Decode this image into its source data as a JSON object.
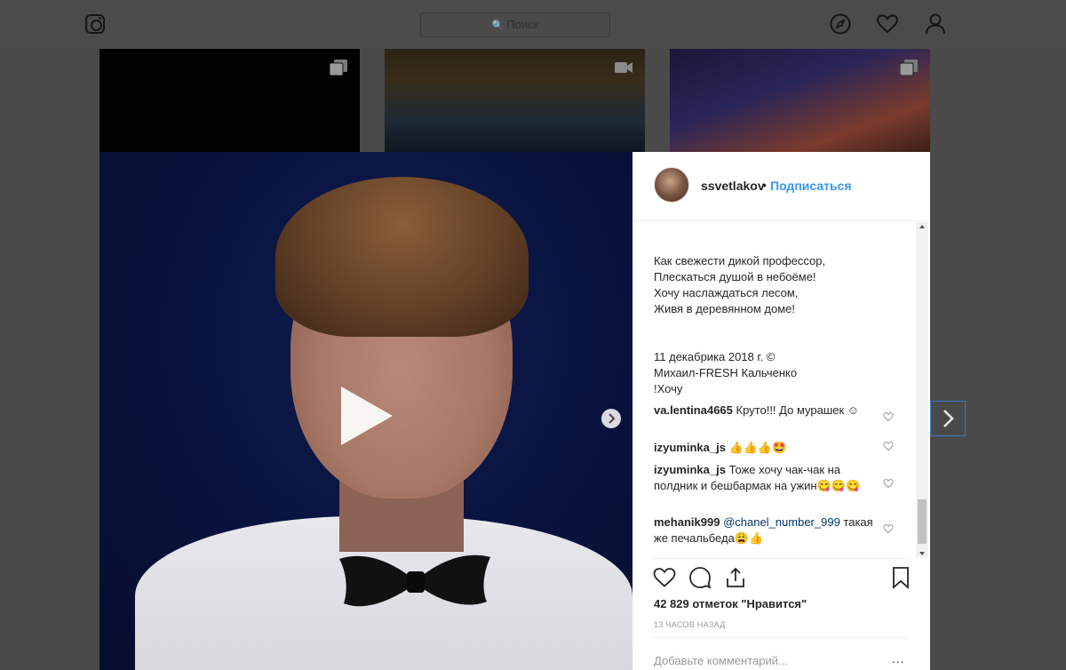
{
  "nav": {
    "logo_icon": "instagram-icon",
    "search_placeholder": "Поиск",
    "icons": [
      "compass-icon",
      "heart-icon",
      "user-icon"
    ]
  },
  "post": {
    "username": "ssvetlakov",
    "separator": "•",
    "follow_label": "Подписаться",
    "caption": "Как свежести дикой профессор,\nПлескаться душой в небоёме!\nХочу наслаждаться лесом,\nЖивя в деревянном доме!\n\n\n11 декабрика 2018 г. ©\nМихаил-FRESH Кальченко\n!Хочу",
    "comments": [
      {
        "user": "va.lentina4665",
        "text": "Круто!!! До мурашек ☺"
      },
      {
        "user": "izyuminka_js",
        "text": "👍👍👍🤩"
      },
      {
        "user": "izyuminka_js",
        "text": "Тоже хочу чак-чак на полдник и бешбармак на ужин😋😋😋"
      },
      {
        "user": "mehanik999",
        "mention": "@chanel_number_999",
        "text": "такая же печальбеда😩👍"
      }
    ],
    "likes_text": "42 829 отметок \"Нравится\"",
    "time_text": "13 часов назад",
    "add_comment_placeholder": "Добавьте комментарий...",
    "more_label": "..."
  },
  "colors": {
    "link": "#3897f0",
    "mention": "#003569",
    "text": "#262626",
    "muted": "#999999"
  }
}
